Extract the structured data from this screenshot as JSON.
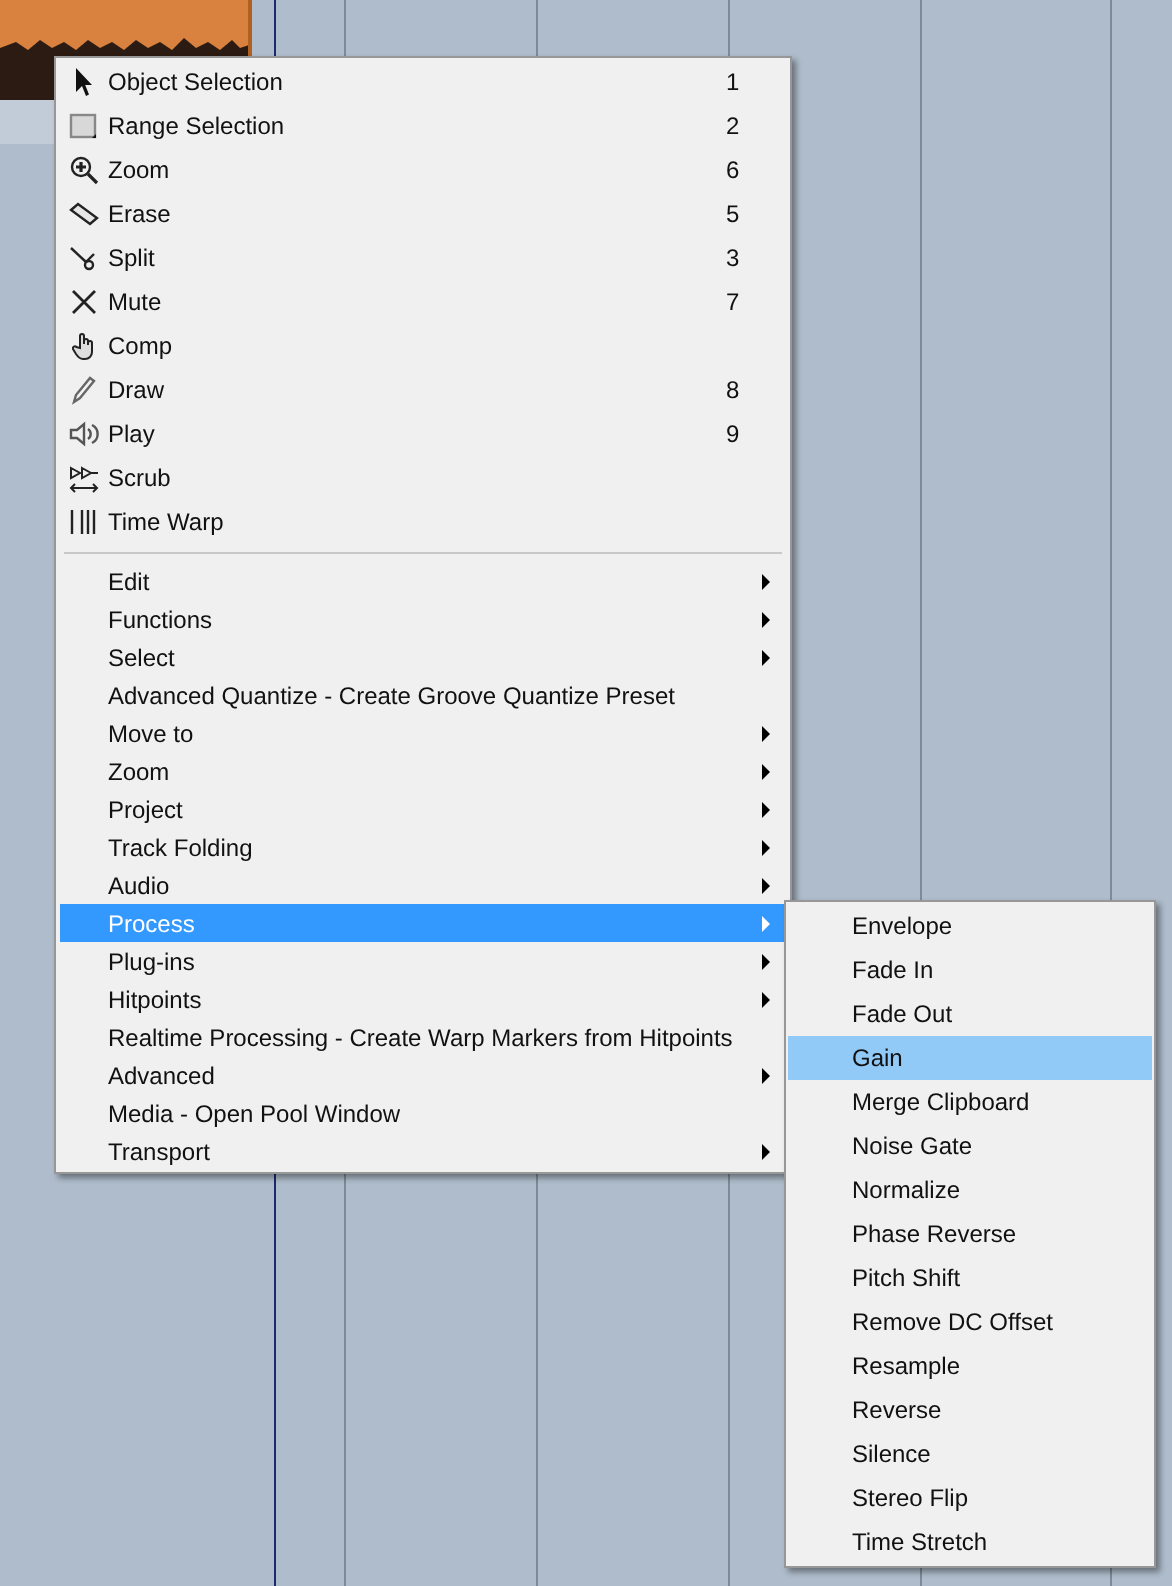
{
  "context_menu": {
    "tools": [
      {
        "label": "Object Selection",
        "shortcut": "1"
      },
      {
        "label": "Range Selection",
        "shortcut": "2"
      },
      {
        "label": "Zoom",
        "shortcut": "6"
      },
      {
        "label": "Erase",
        "shortcut": "5"
      },
      {
        "label": "Split",
        "shortcut": "3"
      },
      {
        "label": "Mute",
        "shortcut": "7"
      },
      {
        "label": "Comp"
      },
      {
        "label": "Draw",
        "shortcut": "8"
      },
      {
        "label": "Play",
        "shortcut": "9"
      },
      {
        "label": "Scrub"
      },
      {
        "label": "Time Warp"
      }
    ],
    "commands": [
      {
        "label": "Edit",
        "has_submenu": true,
        "selected": false
      },
      {
        "label": "Functions",
        "has_submenu": true,
        "selected": false
      },
      {
        "label": "Select",
        "has_submenu": true,
        "selected": false
      },
      {
        "label": "Advanced Quantize - Create Groove Quantize Preset",
        "has_submenu": false,
        "selected": false
      },
      {
        "label": "Move to",
        "has_submenu": true,
        "selected": false
      },
      {
        "label": "Zoom",
        "has_submenu": true,
        "selected": false
      },
      {
        "label": "Project",
        "has_submenu": true,
        "selected": false
      },
      {
        "label": "Track Folding",
        "has_submenu": true,
        "selected": false
      },
      {
        "label": "Audio",
        "has_submenu": true,
        "selected": false
      },
      {
        "label": "Process",
        "has_submenu": true,
        "selected": true
      },
      {
        "label": "Plug-ins",
        "has_submenu": true,
        "selected": false
      },
      {
        "label": "Hitpoints",
        "has_submenu": true,
        "selected": false
      },
      {
        "label": "Realtime Processing - Create Warp Markers from Hitpoints",
        "has_submenu": false,
        "selected": false
      },
      {
        "label": "Advanced",
        "has_submenu": true,
        "selected": false
      },
      {
        "label": "Media - Open Pool Window",
        "has_submenu": false,
        "selected": false
      },
      {
        "label": "Transport",
        "has_submenu": true,
        "selected": false
      }
    ]
  },
  "process_submenu": {
    "items": [
      {
        "label": "Envelope",
        "selected": false
      },
      {
        "label": "Fade In",
        "selected": false
      },
      {
        "label": "Fade Out",
        "selected": false
      },
      {
        "label": "Gain",
        "selected": true
      },
      {
        "label": "Merge Clipboard",
        "selected": false
      },
      {
        "label": "Noise Gate",
        "selected": false
      },
      {
        "label": "Normalize",
        "selected": false
      },
      {
        "label": "Phase Reverse",
        "selected": false
      },
      {
        "label": "Pitch Shift",
        "selected": false
      },
      {
        "label": "Remove DC Offset",
        "selected": false
      },
      {
        "label": "Resample",
        "selected": false
      },
      {
        "label": "Reverse",
        "selected": false
      },
      {
        "label": "Silence",
        "selected": false
      },
      {
        "label": "Stereo Flip",
        "selected": false
      },
      {
        "label": "Time Stretch",
        "selected": false
      }
    ]
  }
}
